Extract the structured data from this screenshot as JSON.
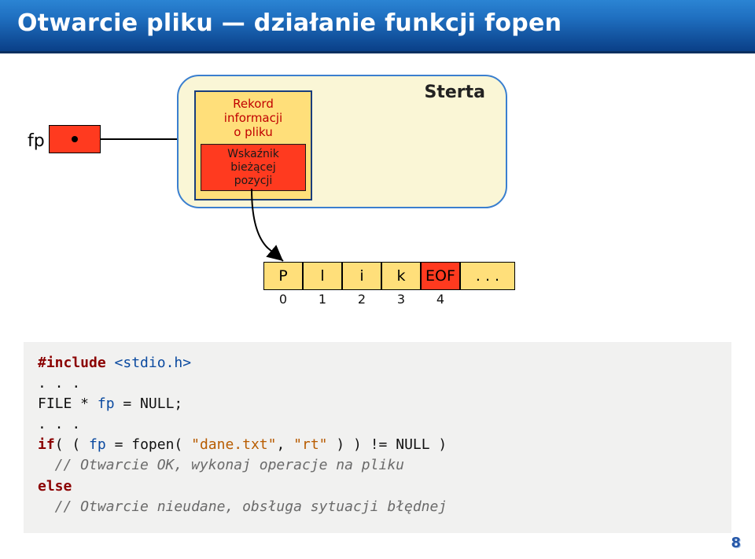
{
  "title": "Otwarcie pliku — działanie funkcji fopen",
  "diagram": {
    "fp_label": "fp",
    "heap_label": "Sterta",
    "record_title_l1": "Rekord",
    "record_title_l2": "informacji",
    "record_title_l3": "o pliku",
    "ptr_l1": "Wskaźnik",
    "ptr_l2": "bieżącej",
    "ptr_l3": "pozycji",
    "buffer": {
      "cells": [
        "P",
        "l",
        "i",
        "k",
        "EOF",
        ". . ."
      ],
      "indices": [
        "0",
        "1",
        "2",
        "3",
        "4"
      ]
    }
  },
  "code": {
    "l1_a": "#include ",
    "l1_b": "<stdio.h>",
    "l2": ". . .",
    "l3_a": "FILE * ",
    "l3_b": "fp",
    "l3_c": " = NULL;",
    "l4": ". . .",
    "l5_a": "if",
    "l5_b": "( ( ",
    "l5_c": "fp",
    "l5_d": " = fopen( ",
    "l5_e": "\"dane.txt\"",
    "l5_f": ", ",
    "l5_g": "\"rt\"",
    "l5_h": " ) ) != NULL )",
    "l6": "  // Otwarcie OK, wykonaj operacje na pliku",
    "l7_a": "else",
    "l8": "  // Otwarcie nieudane, obsługa sytuacji błędnej"
  },
  "page_number": "8"
}
